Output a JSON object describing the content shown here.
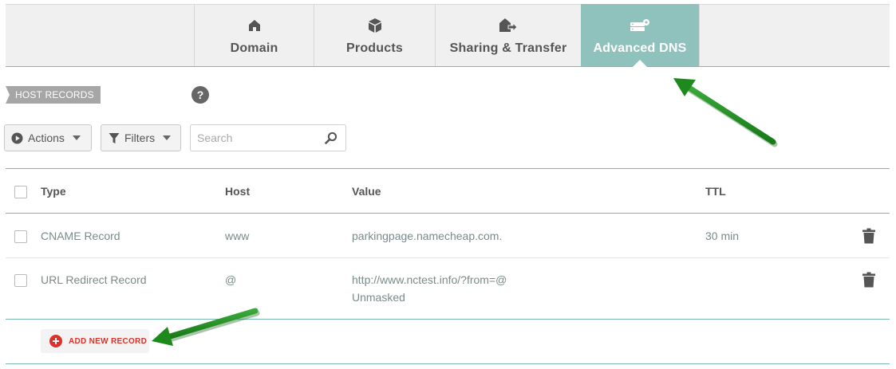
{
  "tabs": [
    {
      "label": "Domain",
      "icon": "home-icon",
      "active": false
    },
    {
      "label": "Products",
      "icon": "box-icon",
      "active": false
    },
    {
      "label": "Sharing & Transfer",
      "icon": "house-arrow-icon",
      "active": false
    },
    {
      "label": "Advanced DNS",
      "icon": "server-gear-icon",
      "active": true
    }
  ],
  "section": {
    "title": "HOST RECORDS",
    "help": "?"
  },
  "toolbar": {
    "actions_label": "Actions",
    "filters_label": "Filters",
    "search_placeholder": "Search"
  },
  "table": {
    "columns": [
      "Type",
      "Host",
      "Value",
      "TTL"
    ],
    "rows": [
      {
        "type": "CNAME Record",
        "host": "www",
        "value": "parkingpage.namecheap.com.",
        "value_sub": "",
        "ttl": "30 min"
      },
      {
        "type": "URL Redirect Record",
        "host": "@",
        "value": "http://www.nctest.info/?from=@",
        "value_sub": "Unmasked",
        "ttl": ""
      }
    ]
  },
  "add_record_label": "ADD NEW RECORD",
  "colors": {
    "accent_teal": "#8fc2bd",
    "rule_teal": "#7cb8b2",
    "add_red": "#d9332b",
    "annotation_arrow_green": "#1e8a1e"
  }
}
